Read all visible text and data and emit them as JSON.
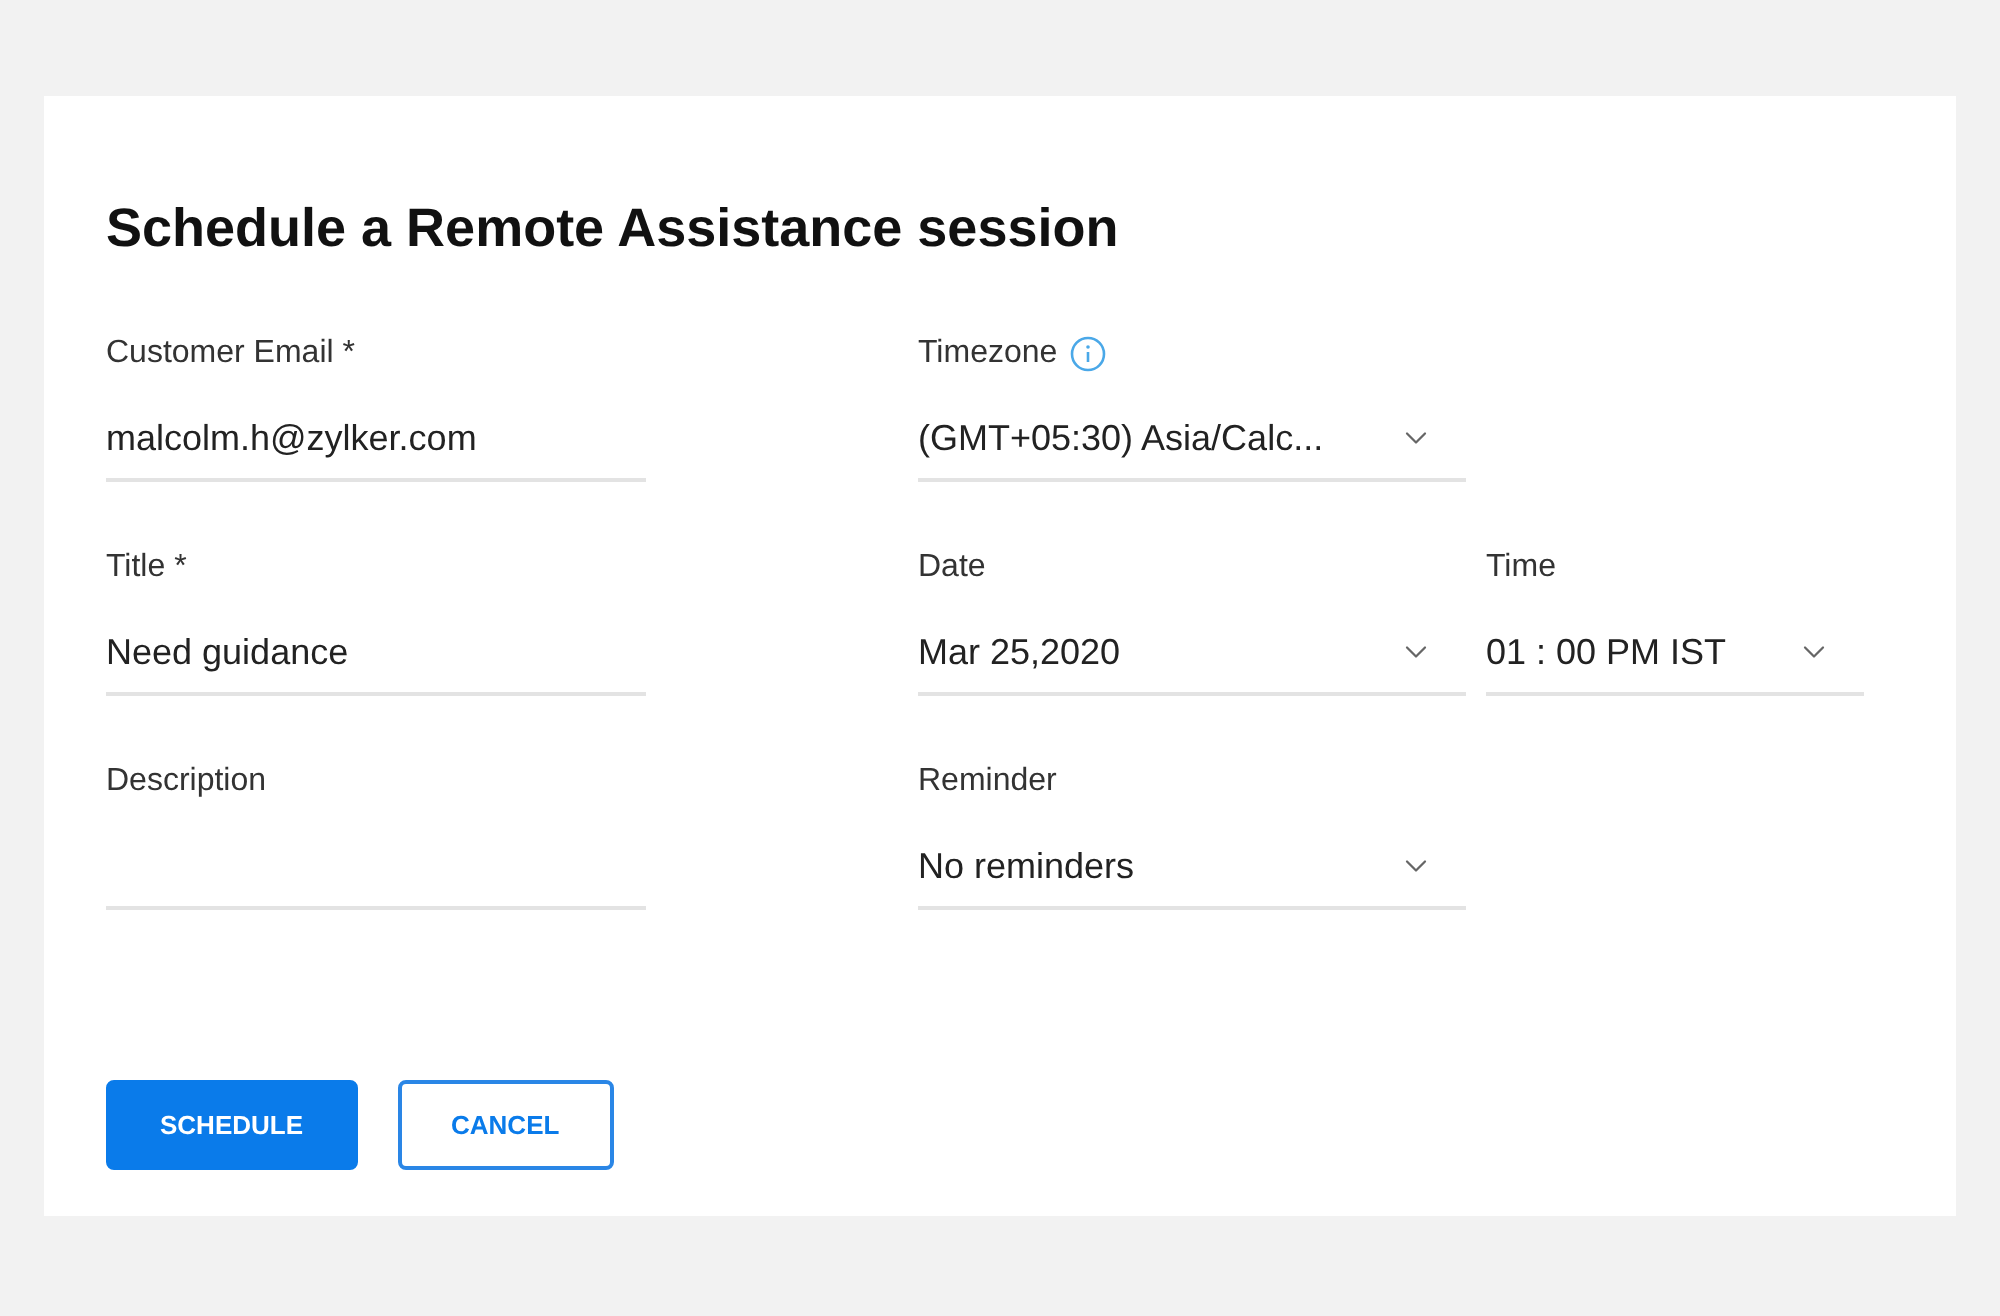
{
  "dialog": {
    "title": "Schedule a Remote Assistance session"
  },
  "rows": [
    {
      "fields": [
        {
          "label": "Customer Email *",
          "kind": "text",
          "value": "malcolm.h@zylker.com",
          "info": false
        },
        {
          "label": "Timezone",
          "kind": "select",
          "value": "(GMT+05:30) Asia/Calc...",
          "info": true
        }
      ]
    },
    {
      "fields": [
        {
          "label": "Title *",
          "kind": "text",
          "value": "Need guidance",
          "info": false
        },
        {
          "label": "Date",
          "kind": "select",
          "value": "Mar 25,2020",
          "info": false
        },
        {
          "label": "Time",
          "kind": "select",
          "value": "01 : 00 PM IST",
          "info": false
        }
      ]
    },
    {
      "fields": [
        {
          "label": "Description",
          "kind": "text",
          "info": false
        },
        {
          "label": "Reminder",
          "kind": "select",
          "value": "No reminders",
          "info": false
        }
      ]
    }
  ],
  "buttons": [
    {
      "label": "SCHEDULE",
      "kind": "primary"
    },
    {
      "label": "CANCEL",
      "kind": "secondary"
    }
  ]
}
